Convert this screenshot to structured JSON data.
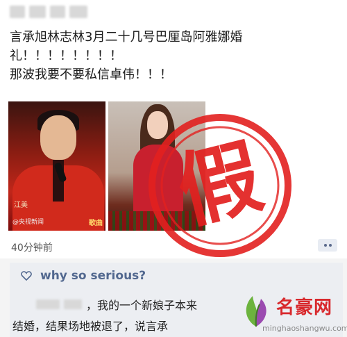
{
  "post": {
    "text_line1": "言承旭林志林3月二十几号巴厘岛阿雅娜婚",
    "text_line2": "礼！！！！！！！！",
    "text_line3": "那波我要不要私信卓伟！！！",
    "time_label": "40分钟前"
  },
  "photo_left": {
    "name_caption": "江美",
    "watermark": "@央视新闻",
    "show_title": "歌曲"
  },
  "likes": {
    "label": "why so serious?"
  },
  "comment": {
    "line1": "，我的一个新娘子本来",
    "line2": "结婚，结果场地被退了，说言承"
  },
  "stamp": {
    "char": "假",
    "color": "#e2201f"
  },
  "brand": {
    "name": "名豪网",
    "url": "minghaoshangwu.com",
    "color": "#d8282c"
  }
}
